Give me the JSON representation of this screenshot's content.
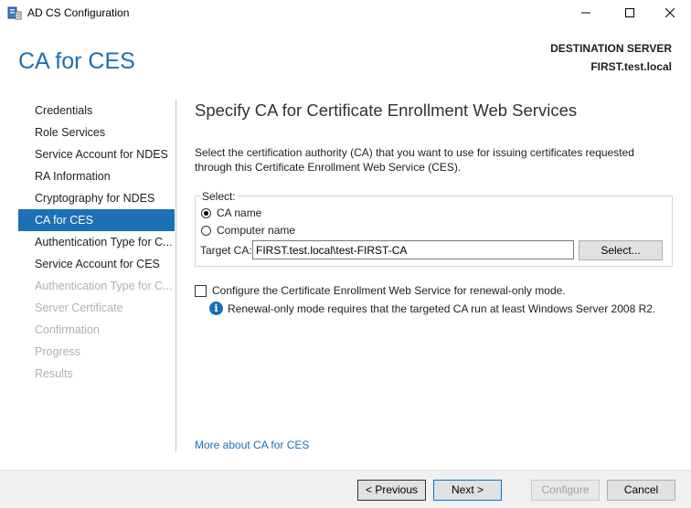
{
  "window": {
    "title": "AD CS Configuration",
    "icons": [
      "app-server-icon",
      "minimize-icon",
      "maximize-icon",
      "close-icon"
    ]
  },
  "header": {
    "page_title": "CA for CES",
    "destination_label": "DESTINATION SERVER",
    "destination_value": "FIRST.test.local"
  },
  "sidebar": {
    "items": [
      {
        "label": "Credentials",
        "state": "normal"
      },
      {
        "label": "Role Services",
        "state": "normal"
      },
      {
        "label": "Service Account for NDES",
        "state": "normal"
      },
      {
        "label": "RA Information",
        "state": "normal"
      },
      {
        "label": "Cryptography for NDES",
        "state": "normal"
      },
      {
        "label": "CA for CES",
        "state": "active"
      },
      {
        "label": "Authentication Type for C...",
        "state": "normal"
      },
      {
        "label": "Service Account for CES",
        "state": "normal"
      },
      {
        "label": "Authentication Type for C...",
        "state": "disabled"
      },
      {
        "label": "Server Certificate",
        "state": "disabled"
      },
      {
        "label": "Confirmation",
        "state": "disabled"
      },
      {
        "label": "Progress",
        "state": "disabled"
      },
      {
        "label": "Results",
        "state": "disabled"
      }
    ]
  },
  "main": {
    "heading": "Specify CA for Certificate Enrollment Web Services",
    "description": "Select the certification authority (CA) that you want to use for issuing certificates requested through this Certificate Enrollment Web Service (CES).",
    "select_group": {
      "legend": "Select:",
      "options": [
        {
          "label": "CA name",
          "checked": true
        },
        {
          "label": "Computer name",
          "checked": false
        }
      ],
      "target_label": "Target CA:",
      "target_value": "FIRST.test.local\\test-FIRST-CA",
      "select_button": "Select..."
    },
    "renewal_checkbox": {
      "label": "Configure the Certificate Enrollment Web Service for renewal-only mode.",
      "checked": false
    },
    "info": {
      "text": "Renewal-only mode requires that the targeted CA run at least Windows Server 2008 R2."
    },
    "more_link": "More about CA for CES"
  },
  "footer": {
    "previous": "< Previous",
    "next": "Next >",
    "configure": "Configure",
    "cancel": "Cancel"
  },
  "colors": {
    "accent": "#1d6fb6",
    "disabled_text": "#b0b0b0",
    "footer_bg": "#f0f0f0"
  }
}
